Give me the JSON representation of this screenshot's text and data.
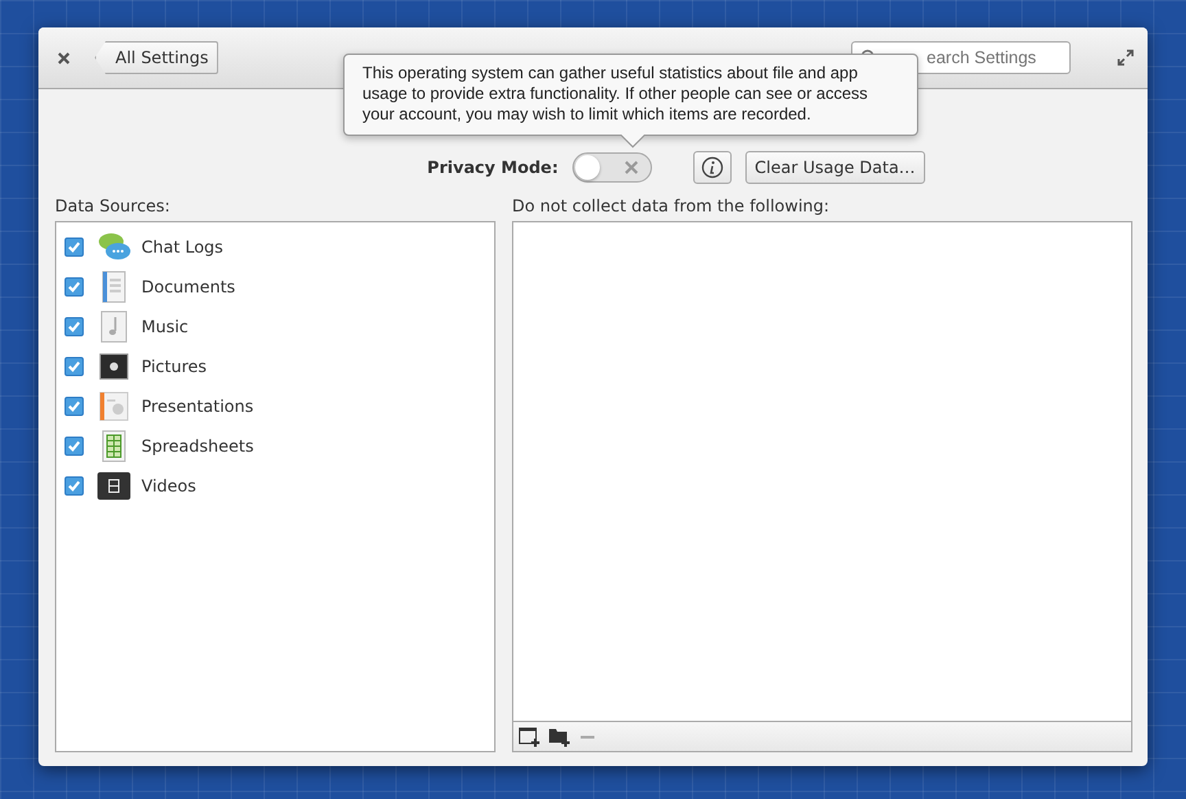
{
  "window": {
    "back_button": "All Settings",
    "search": {
      "placeholder": "earch Settings"
    }
  },
  "tooltip": {
    "text": "This operating system can gather useful statistics about file and app usage to provide extra functionality. If other people can see or access your account, you may wish to limit which items are recorded."
  },
  "privacy_mode": {
    "label": "Privacy Mode:",
    "on": false
  },
  "clear_button": "Clear Usage Data…",
  "data_sources": {
    "label": "Data Sources:",
    "items": [
      {
        "label": "Chat Logs",
        "checked": true
      },
      {
        "label": "Documents",
        "checked": true
      },
      {
        "label": "Music",
        "checked": true
      },
      {
        "label": "Pictures",
        "checked": true
      },
      {
        "label": "Presentations",
        "checked": true
      },
      {
        "label": "Spreadsheets",
        "checked": true
      },
      {
        "label": "Videos",
        "checked": true
      }
    ]
  },
  "exclusions": {
    "label": "Do not collect data from the following:"
  }
}
